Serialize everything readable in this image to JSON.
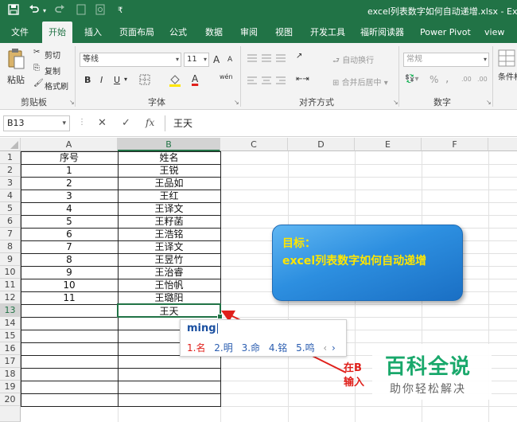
{
  "window": {
    "title": "excel列表数字如何自动递增.xlsx - Ex",
    "quick_access": [
      "save-icon",
      "undo-icon",
      "redo-icon",
      "touch-mode-icon",
      "customize-icon"
    ]
  },
  "ribbon_tabs": [
    {
      "label": "文件"
    },
    {
      "label": "开始"
    },
    {
      "label": "插入"
    },
    {
      "label": "页面布局"
    },
    {
      "label": "公式"
    },
    {
      "label": "数据"
    },
    {
      "label": "审阅"
    },
    {
      "label": "视图"
    },
    {
      "label": "开发工具"
    },
    {
      "label": "福昕阅读器"
    },
    {
      "label": "Power Pivot"
    },
    {
      "label": "view"
    }
  ],
  "ribbon": {
    "clipboard": {
      "paste": "粘贴",
      "cut": "剪切",
      "copy": "复制",
      "format_painter": "格式刷",
      "group_label": "剪贴板"
    },
    "font": {
      "font_name": "等线",
      "font_size": "11",
      "bold": "B",
      "italic": "I",
      "underline": "U",
      "grow": "A",
      "shrink": "A",
      "font_color": "A",
      "wen": "wén",
      "group_label": "字体"
    },
    "alignment": {
      "wrap": "自动换行",
      "merge": "合并后居中",
      "group_label": "对齐方式"
    },
    "number": {
      "format": "常规",
      "percent": "%",
      "comma": ",",
      "inc_decimal": ".00",
      "dec_decimal": ".00",
      "group_label": "数字"
    },
    "styles": {
      "conditional": "条件格"
    }
  },
  "formula_bar": {
    "name_box": "B13",
    "cancel": "✕",
    "enter": "✓",
    "fx": "fx",
    "value": "王天"
  },
  "sheet": {
    "columns": [
      "A",
      "B",
      "C",
      "D",
      "E",
      "F"
    ],
    "rows": [
      "1",
      "2",
      "3",
      "4",
      "5",
      "6",
      "7",
      "8",
      "9",
      "10",
      "11",
      "12",
      "13",
      "14",
      "15",
      "16",
      "17",
      "18",
      "19",
      "20"
    ],
    "header_row": {
      "a": "序号",
      "b": "姓名"
    },
    "data": [
      {
        "a": "1",
        "b": "王锐"
      },
      {
        "a": "2",
        "b": "王品如"
      },
      {
        "a": "3",
        "b": "王红"
      },
      {
        "a": "4",
        "b": "王译文"
      },
      {
        "a": "5",
        "b": "王籽菡"
      },
      {
        "a": "6",
        "b": "王浩铭"
      },
      {
        "a": "7",
        "b": "王译文"
      },
      {
        "a": "8",
        "b": "王昱竹"
      },
      {
        "a": "9",
        "b": "王治睿"
      },
      {
        "a": "10",
        "b": "王怡帆"
      },
      {
        "a": "11",
        "b": "王璐阳"
      }
    ],
    "active_cell_value": "王天"
  },
  "callout": {
    "line1": "目标：",
    "line2": "excel列表数字如何自动递增"
  },
  "ime": {
    "composition": "ming",
    "candidates": [
      "1.名",
      "2.明",
      "3.命",
      "4.铭",
      "5.鸣"
    ],
    "nav_prev": "‹",
    "nav_next": "›"
  },
  "instruction": {
    "line1": "在B",
    "line2": "输入"
  },
  "watermark": {
    "title": "百科全说",
    "subtitle": "助你轻松解决"
  },
  "colors": {
    "excel_green": "#217346",
    "callout_blue": "#2d8fe0",
    "callout_text": "#ffe600",
    "arrow_red": "#e0201b",
    "watermark_green": "#19a86b"
  }
}
